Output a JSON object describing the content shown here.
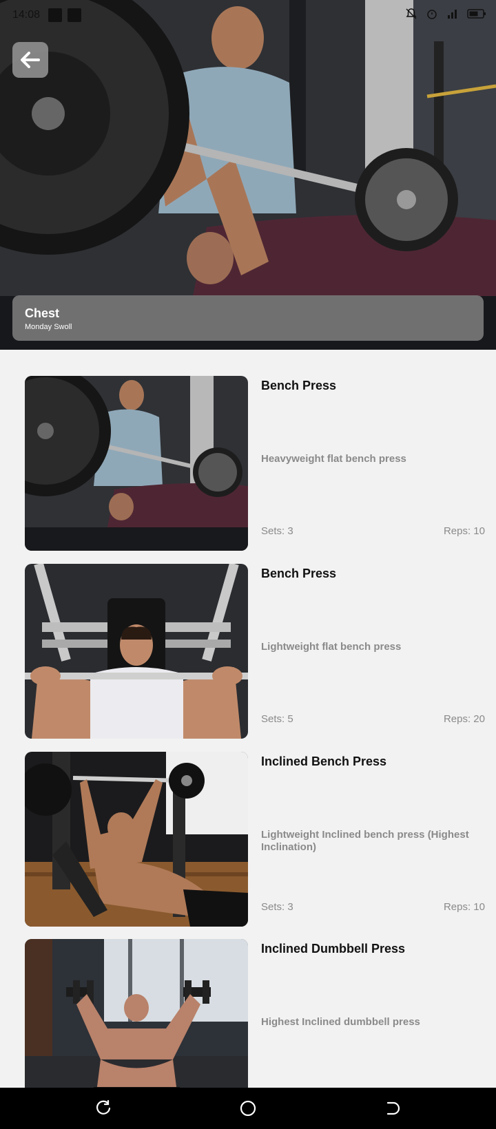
{
  "status_bar": {
    "time": "14:08"
  },
  "header": {
    "title": "Chest",
    "subtitle": "Monday Swoll"
  },
  "exercises": [
    {
      "name": "Bench Press",
      "description": "Heavyweight flat bench press",
      "sets": "Sets: 3",
      "reps": "Reps: 10",
      "image": "gym-bench-press-spotter-photo"
    },
    {
      "name": "Bench Press",
      "description": "Lightweight flat bench press",
      "sets": "Sets: 5",
      "reps": "Reps: 20",
      "image": "man-bench-press-barbell-photo"
    },
    {
      "name": "Inclined Bench Press",
      "description": "Lightweight Inclined bench press (Highest Inclination)",
      "sets": "Sets: 3",
      "reps": "Reps: 10",
      "image": "incline-bench-press-photo"
    },
    {
      "name": "Inclined Dumbbell Press",
      "description": "Highest Inclined dumbbell press",
      "sets": "",
      "reps": "",
      "image": "incline-dumbbell-press-photo"
    }
  ],
  "colors": {
    "accent_dark": "#111111",
    "muted_text": "#8a8a8a",
    "card_overlay": "#787878",
    "background": "#f2f2f2"
  }
}
